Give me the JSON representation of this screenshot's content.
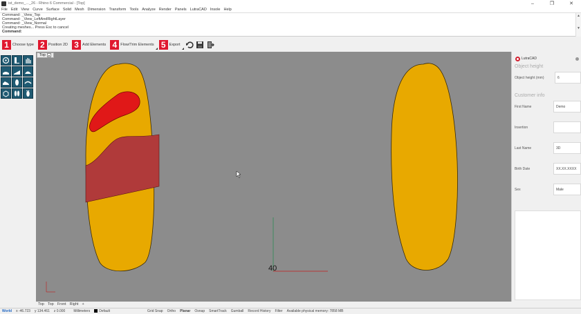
{
  "window": {
    "title": "ist_demo_..._26 - Rhino 6 Commercial - [Top]",
    "minimize": "–",
    "maximize": "❐",
    "close": "✕"
  },
  "menu": [
    "File",
    "Edit",
    "View",
    "Curve",
    "Surface",
    "Solid",
    "Mesh",
    "Dimension",
    "Transform",
    "Tools",
    "Analyze",
    "Render",
    "Panels",
    "LutraCAD",
    "Insole",
    "Help"
  ],
  "command_history": [
    "Command: _View_Top",
    "Command: _View_LeftAndRightLayer",
    "Command: _View_Normal",
    "Creating meshes... Press Esc to cancel"
  ],
  "command_prompt": "Command:",
  "toolbar": {
    "steps": [
      {
        "num": "1",
        "label": "Choose type"
      },
      {
        "num": "2",
        "label": "Position 2D"
      },
      {
        "num": "3",
        "label": "Add Elements"
      },
      {
        "num": "4",
        "label": "Flow/Trim Elements"
      },
      {
        "num": "5",
        "label": "Export"
      }
    ]
  },
  "viewport": {
    "name": "Top",
    "dropdown": "▾",
    "axis_label": "40"
  },
  "panel": {
    "title": "LutraCAD",
    "section_height": "Object height",
    "object_height_label": "Object height (mm)",
    "object_height_value": "6",
    "section_customer": "Customer info",
    "fields": [
      {
        "label": "First Name",
        "value": "Demo"
      },
      {
        "label": "Insertion",
        "value": ""
      },
      {
        "label": "Last Name",
        "value": "3D"
      },
      {
        "label": "Birth Date",
        "value": "XX.XX.XXXX"
      },
      {
        "label": "Sex",
        "value": "Male"
      }
    ]
  },
  "view_tabs": [
    "Top",
    "Top",
    "Front",
    "Right",
    "+"
  ],
  "status": {
    "cplane": "World",
    "x": "x -46.723",
    "y": "y 134.461",
    "z": "z 0.000",
    "units": "Millimeters",
    "layer": "Default",
    "toggles": [
      "Grid Snap",
      "Ortho",
      "Planar",
      "Osnap",
      "SmartTrack",
      "Gumball",
      "Record History",
      "Filter"
    ],
    "memory": "Available physical memory: 7858 MB"
  },
  "colors": {
    "insole": "#e8a900",
    "accent": "#e0182f",
    "viewport": "#8c8c8c",
    "met_pad": "#dd1a1a",
    "wedge": "#b03a3a"
  }
}
